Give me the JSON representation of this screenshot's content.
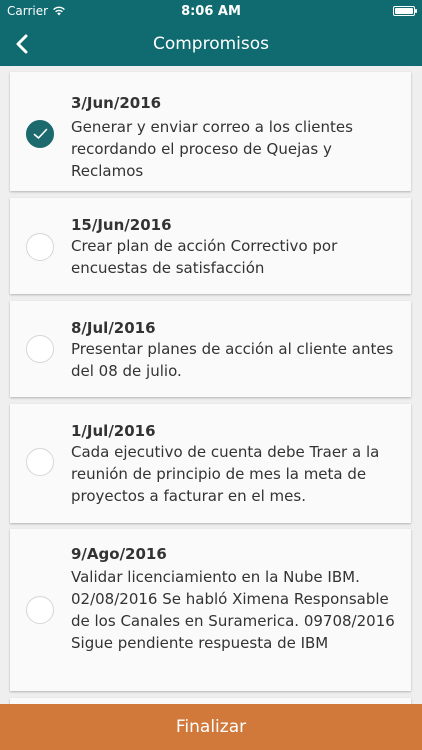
{
  "statusbar": {
    "carrier": "Carrier",
    "time": "8:06 AM"
  },
  "navbar": {
    "title": "Compromisos"
  },
  "tasks": [
    {
      "date": "3/Jun/2016",
      "text": "Generar y enviar correo a los clientes recordando el proceso de Quejas y Reclamos",
      "checked": true
    },
    {
      "date": "15/Jun/2016",
      "text": "Crear plan de acción Correctivo por encuestas de satisfacción",
      "checked": false
    },
    {
      "date": "8/Jul/2016",
      "text": "Presentar planes de acción al cliente antes del 08 de julio.",
      "checked": false
    },
    {
      "date": "1/Jul/2016",
      "text": "Cada ejecutivo de cuenta debe Traer a la reunión de principio de mes la meta de proyectos a facturar en el mes.",
      "checked": false
    },
    {
      "date": "9/Ago/2016",
      "text": "Validar licenciamiento en la Nube IBM. 02/08/2016 Se habló Ximena Responsable de los Canales en Suramerica.  09708/2016 Sigue pendiente respuesta de IBM",
      "checked": false
    }
  ],
  "footer": {
    "label": "Finalizar"
  },
  "colors": {
    "primary": "#0f6b70",
    "accent": "#d1793a",
    "check": "#1c6a6e"
  }
}
